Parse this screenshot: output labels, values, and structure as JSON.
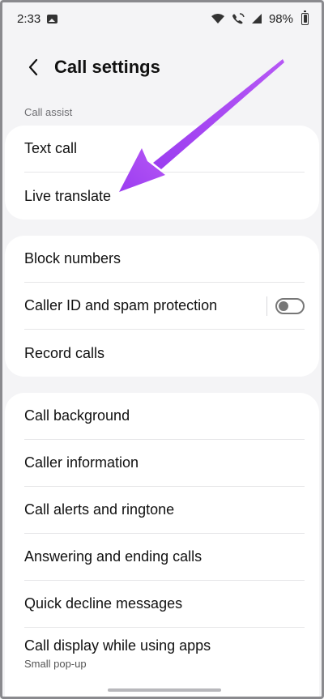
{
  "status_bar": {
    "time": "2:33",
    "battery": "98%",
    "icons": [
      "gallery-icon",
      "wifi-icon",
      "wifi-calling-icon",
      "signal-icon",
      "battery-icon"
    ]
  },
  "header": {
    "back_icon": "chevron-left-icon",
    "title": "Call settings"
  },
  "sections": {
    "call_assist": {
      "label": "Call assist",
      "items": [
        {
          "label": "Text call"
        },
        {
          "label": "Live translate"
        }
      ]
    },
    "group2": {
      "items": [
        {
          "label": "Block numbers"
        },
        {
          "label": "Caller ID and spam protection",
          "toggle": false
        },
        {
          "label": "Record calls"
        }
      ]
    },
    "group3": {
      "items": [
        {
          "label": "Call background"
        },
        {
          "label": "Caller information"
        },
        {
          "label": "Call alerts and ringtone"
        },
        {
          "label": "Answering and ending calls"
        },
        {
          "label": "Quick decline messages"
        },
        {
          "label": "Call display while using apps",
          "sub": "Small pop-up"
        }
      ]
    }
  },
  "colors": {
    "background": "#f4f4f6",
    "card": "#ffffff",
    "annotation_arrow": "#a543f0"
  }
}
